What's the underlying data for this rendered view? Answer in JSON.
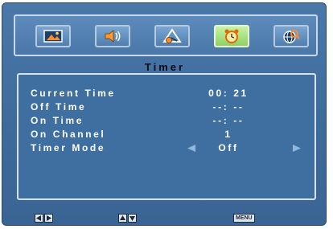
{
  "menu": {
    "tabs": [
      {
        "name": "picture",
        "icon": "picture-icon",
        "active": false
      },
      {
        "name": "sound",
        "icon": "speaker-icon",
        "active": false
      },
      {
        "name": "setup",
        "icon": "setup-icon",
        "active": false
      },
      {
        "name": "timer",
        "icon": "alarm-clock-icon",
        "active": true
      },
      {
        "name": "options",
        "icon": "globe-search-icon",
        "active": false
      }
    ]
  },
  "section_title": "Timer",
  "settings": [
    {
      "label": "Current Time",
      "value": "00: 21"
    },
    {
      "label": "Off Time",
      "value": "--: --"
    },
    {
      "label": "On Time",
      "value": "--: --"
    },
    {
      "label": "On Channel",
      "value": "1"
    },
    {
      "label": "Timer Mode",
      "value": "Off"
    }
  ],
  "footer": {
    "left_right_icon": "left-right-arrow-keys-icon",
    "up_down_icon": "up-down-arrow-keys-icon",
    "menu_key_label": "MENU"
  },
  "colors": {
    "background": "#3e6c9c",
    "active_tab": "#a8e07c",
    "text": "#ffffff",
    "title": "#0a0a14",
    "arrow": "#8fb7e0"
  }
}
